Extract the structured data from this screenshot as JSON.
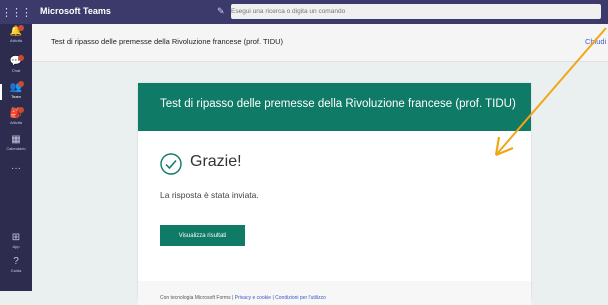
{
  "topbar": {
    "app_name": "Microsoft Teams",
    "waffle_icon": "waffle-icon",
    "compose_icon": "compose-icon",
    "search_placeholder": "Esegui una ricerca o digita un comando"
  },
  "rail": {
    "items": [
      {
        "label": "Attività",
        "icon": "bell-icon",
        "glyph": "🔔",
        "badge": true
      },
      {
        "label": "Chat",
        "icon": "chat-icon",
        "glyph": "💬",
        "badge": true
      },
      {
        "label": "Team",
        "icon": "teams-icon",
        "glyph": "👥",
        "badge": true,
        "active": true
      },
      {
        "label": "Attività",
        "icon": "assignments-icon",
        "glyph": "🎒",
        "badge": true
      },
      {
        "label": "Calendario",
        "icon": "calendar-icon",
        "glyph": "▦",
        "badge": false
      },
      {
        "label": "",
        "icon": "more-icon",
        "glyph": "···",
        "badge": false
      },
      {
        "label": "App",
        "icon": "apps-icon",
        "glyph": "⊞",
        "badge": false
      },
      {
        "label": "Guida",
        "icon": "help-icon",
        "glyph": "?",
        "badge": false
      }
    ]
  },
  "header": {
    "tab_title": "Test di ripasso delle premesse della Rivoluzione francese (prof. TIDU)",
    "close_label": "Chiudi"
  },
  "form": {
    "banner_title": "Test di ripasso delle premesse della Rivoluzione francese  (prof. TIDU)",
    "thanks": "Grazie!",
    "sent_message": "La risposta è stata inviata.",
    "view_results_label": "Visualizza risultati",
    "footer": {
      "prefix": "Con tecnologia Microsoft Forms | ",
      "privacy": "Privacy e cookie",
      "separator": " | ",
      "terms": "Condizioni per l'utilizzo"
    }
  },
  "colors": {
    "brand_green": "#0f7a65",
    "teams_purple": "#3b3a6b",
    "arrow": "#f2a516"
  }
}
